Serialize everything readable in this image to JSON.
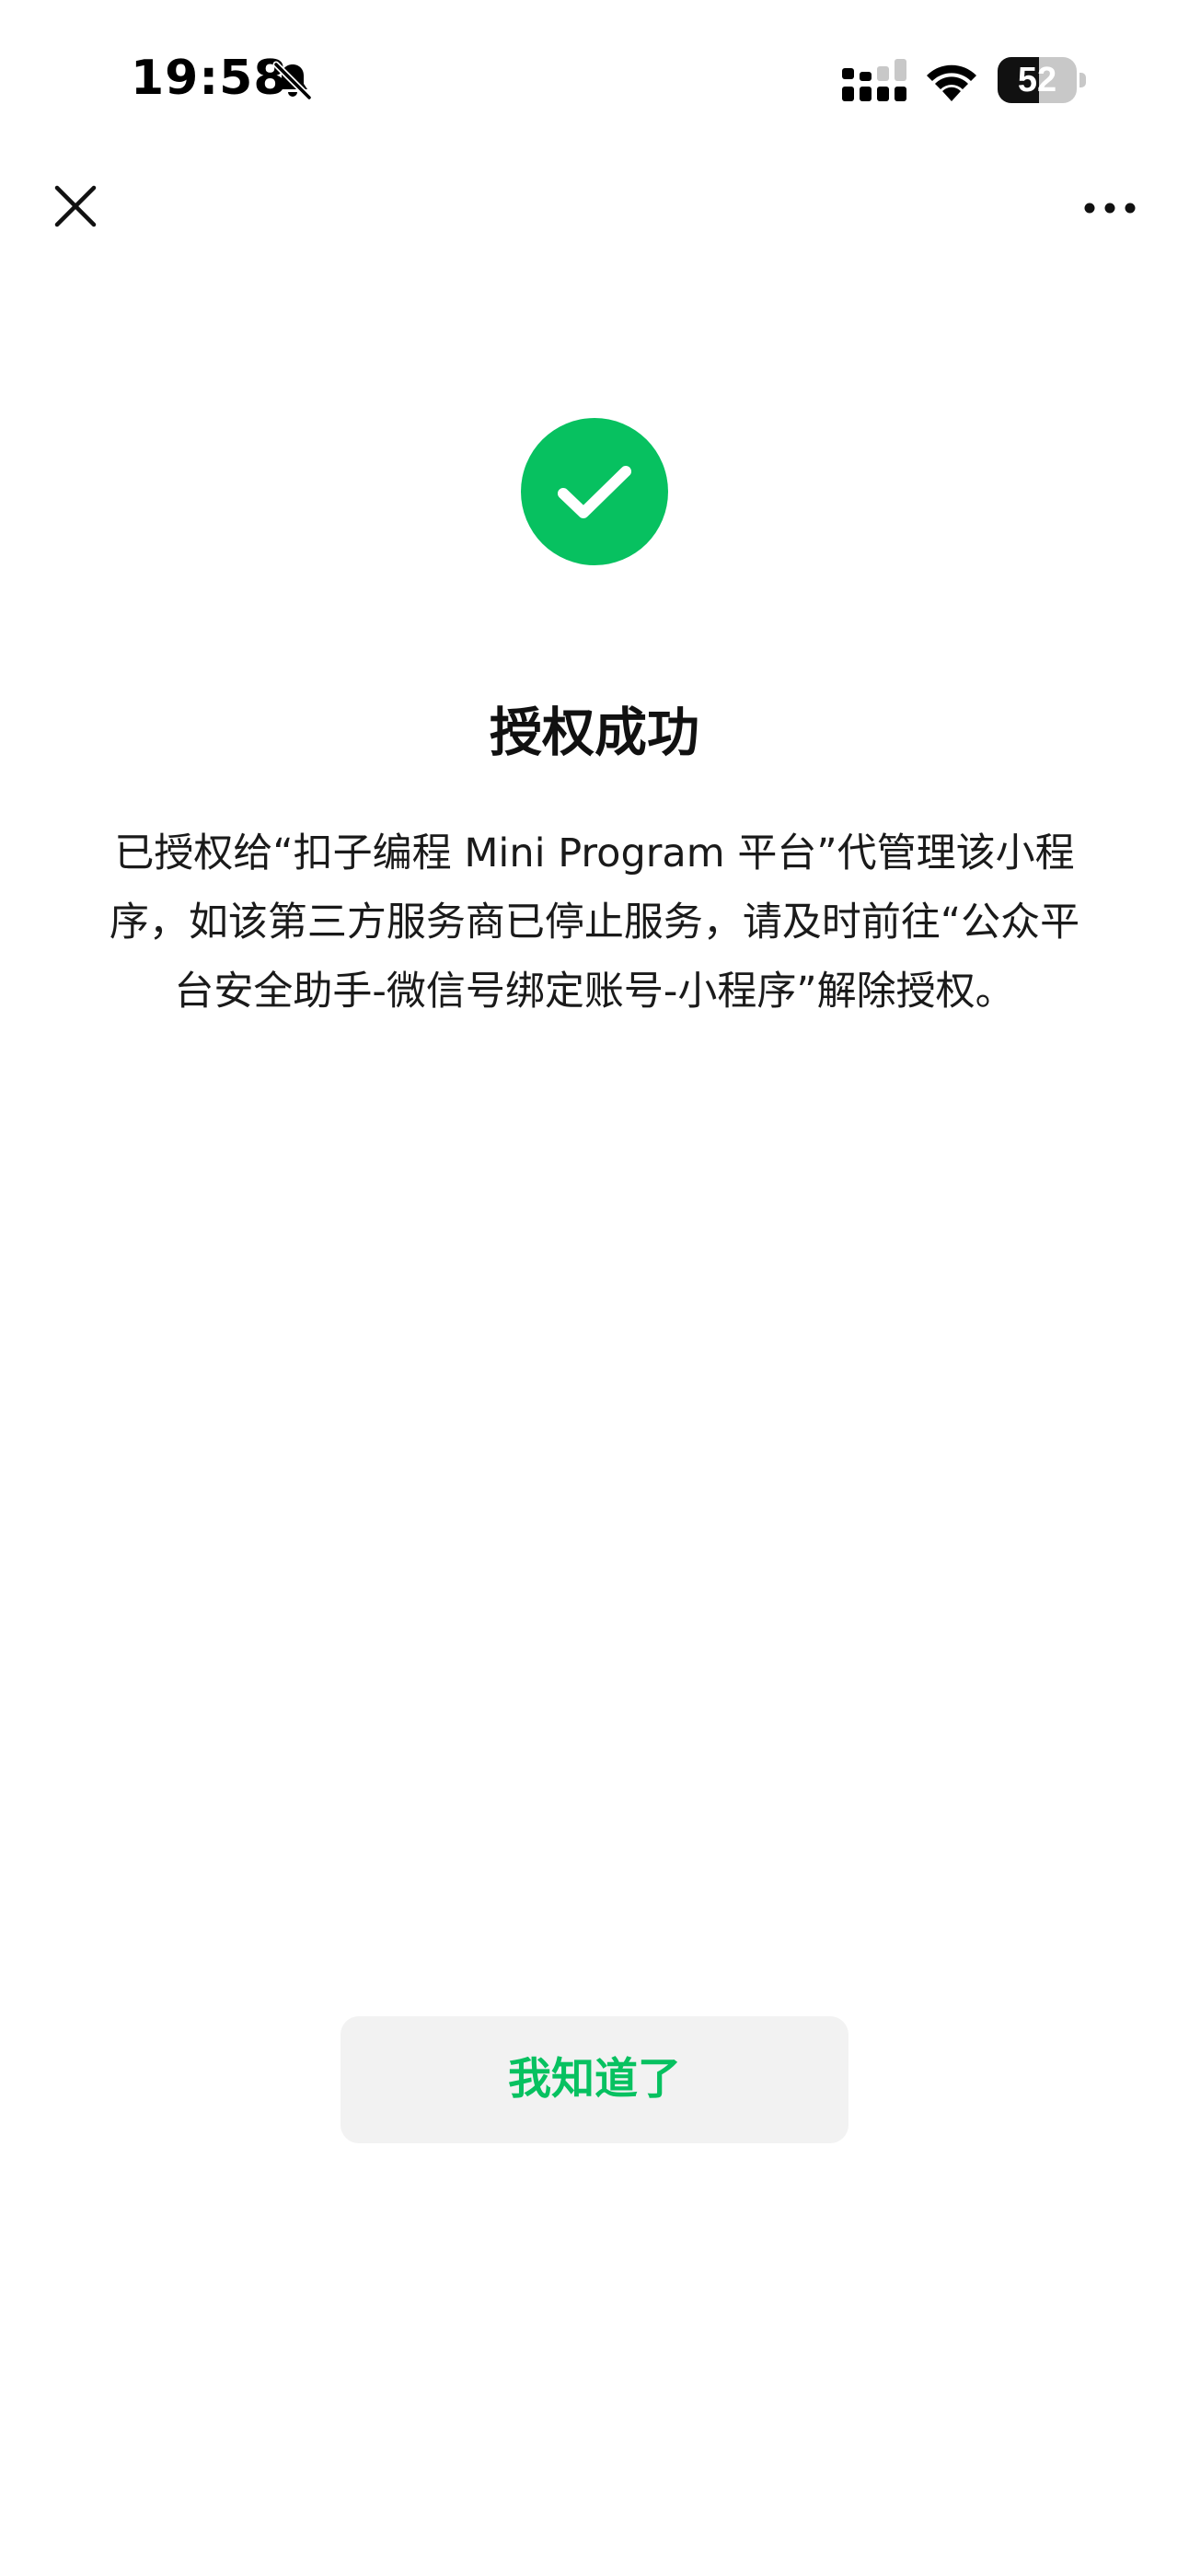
{
  "status_bar": {
    "time": "19:58",
    "battery_level": "52",
    "icons": [
      "bell-slash-icon",
      "cellular-signal-icon",
      "wifi-icon",
      "battery-icon"
    ]
  },
  "nav": {
    "close_icon": "close-icon",
    "more_icon": "more-icon"
  },
  "result": {
    "icon": "success-check-icon",
    "title": "授权成功",
    "description": "已授权给“扣子编程 Mini Program 平台”代管理该小程序，如该第三方服务商已停止服务，请及时前往“公众平台安全助手-微信号绑定账号-小程序”解除授权。"
  },
  "actions": {
    "ack_label": "我知道了"
  },
  "colors": {
    "accent": "#07c160",
    "button_bg": "#f2f2f2",
    "text": "#111111",
    "background": "#ffffff"
  }
}
